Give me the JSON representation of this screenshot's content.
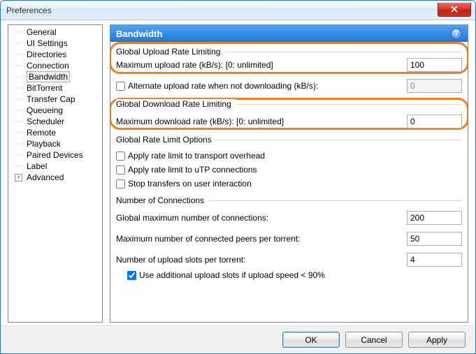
{
  "window": {
    "title": "Preferences"
  },
  "sidebar": {
    "items": [
      {
        "label": "General"
      },
      {
        "label": "UI Settings"
      },
      {
        "label": "Directories"
      },
      {
        "label": "Connection"
      },
      {
        "label": "Bandwidth"
      },
      {
        "label": "BitTorrent"
      },
      {
        "label": "Transfer Cap"
      },
      {
        "label": "Queueing"
      },
      {
        "label": "Scheduler"
      },
      {
        "label": "Remote"
      },
      {
        "label": "Playback"
      },
      {
        "label": "Paired Devices"
      },
      {
        "label": "Label"
      },
      {
        "label": "Advanced"
      }
    ]
  },
  "panel": {
    "title": "Bandwidth",
    "help": "?",
    "groups": {
      "upload": {
        "title": "Global Upload Rate Limiting",
        "max_label": "Maximum upload rate (kB/s): [0: unlimited]",
        "max_value": "100",
        "alt_label": "Alternate upload rate when not downloading (kB/s):",
        "alt_value": "0"
      },
      "download": {
        "title": "Global Download Rate Limiting",
        "max_label": "Maximum download rate (kB/s): [0: unlimited]",
        "max_value": "0"
      },
      "options": {
        "title": "Global Rate Limit Options",
        "opt1": "Apply rate limit to transport overhead",
        "opt2": "Apply rate limit to uTP connections",
        "opt3": "Stop transfers on user interaction"
      },
      "conn": {
        "title": "Number of Connections",
        "global_label": "Global maximum number of connections:",
        "global_value": "200",
        "peers_label": "Maximum number of connected peers per torrent:",
        "peers_value": "50",
        "slots_label": "Number of upload slots per torrent:",
        "slots_value": "4",
        "extra_slots_label": "Use additional upload slots if upload speed < 90%"
      }
    }
  },
  "buttons": {
    "ok": "OK",
    "cancel": "Cancel",
    "apply": "Apply"
  }
}
